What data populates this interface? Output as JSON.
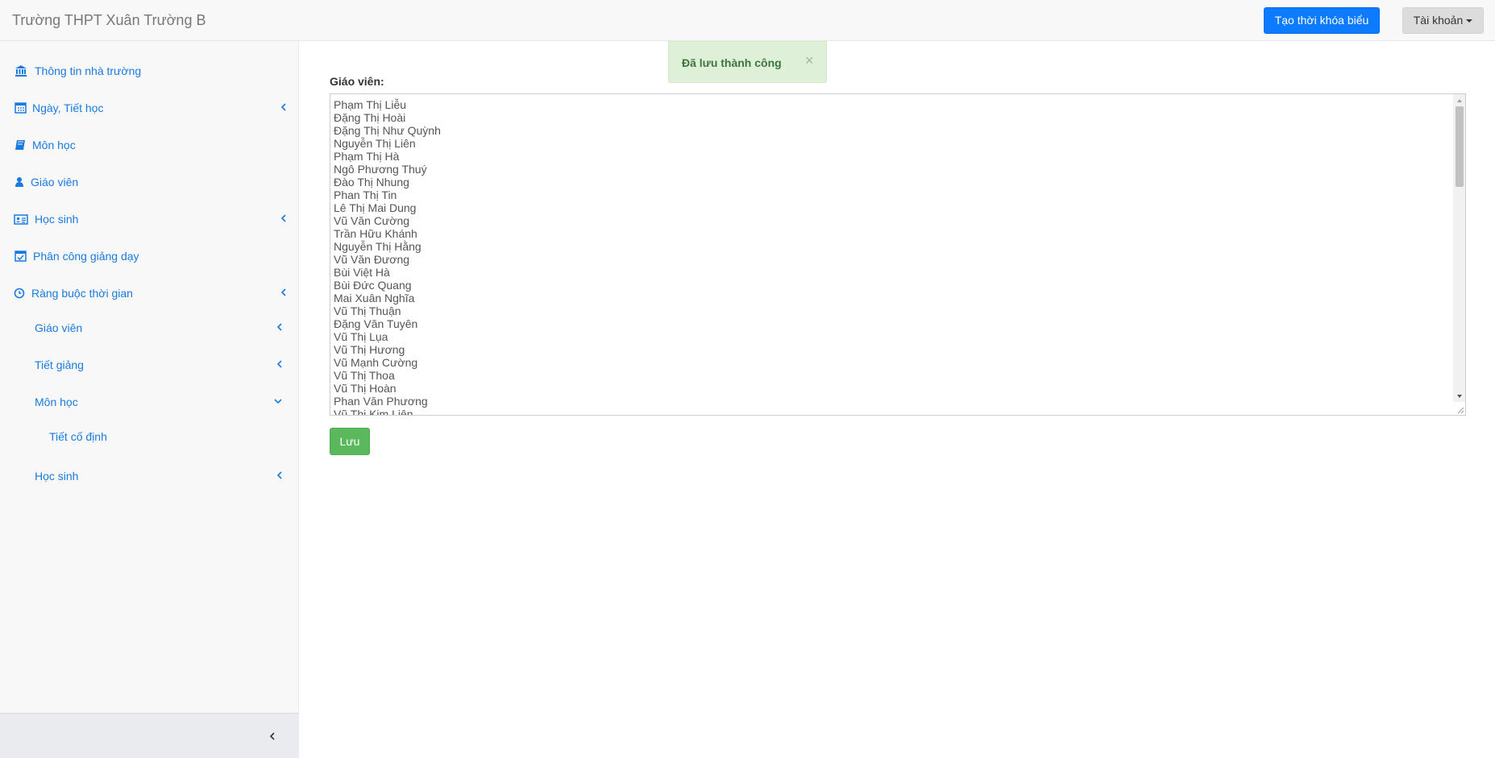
{
  "navbar": {
    "brand": "Trường THPT Xuân Trường B",
    "create_button": "Tạo thời khóa biểu",
    "account_button": "Tài khoản"
  },
  "sidebar": {
    "items": [
      {
        "label": "Thông tin nhà trường",
        "icon": "bank-icon",
        "chevron": "none"
      },
      {
        "label": "Ngày, Tiết học",
        "icon": "calendar-icon",
        "chevron": "left"
      },
      {
        "label": "Môn học",
        "icon": "book-icon",
        "chevron": "none"
      },
      {
        "label": "Giáo viên",
        "icon": "user-icon",
        "chevron": "none"
      },
      {
        "label": "Học sinh",
        "icon": "id-card-icon",
        "chevron": "left"
      },
      {
        "label": "Phân công giảng dạy",
        "icon": "calendar-check-icon",
        "chevron": "none"
      },
      {
        "label": "Ràng buộc thời gian",
        "icon": "clock-icon",
        "chevron": "left"
      }
    ],
    "subitems": [
      {
        "label": "Giáo viên",
        "chevron": "left"
      },
      {
        "label": "Tiết giảng",
        "chevron": "left"
      },
      {
        "label": "Môn học",
        "chevron": "down"
      }
    ],
    "subsubitems": [
      {
        "label": "Tiết cố định"
      }
    ],
    "last_subitem": {
      "label": "Học sinh",
      "chevron": "left"
    }
  },
  "alert": {
    "message": "Đã lưu thành công",
    "close": "×"
  },
  "form": {
    "label": "Giáo viên:",
    "teachers": [
      "Phạm Thị Liễu",
      "Đặng Thị Hoài",
      "Đặng Thị Như Quỳnh",
      "Nguyễn Thị Liên",
      "Phạm Thị Hà",
      "Ngô Phương Thuý",
      "Đào Thị Nhung",
      "Phan Thị Tin",
      "Lê Thị Mai Dung",
      "Vũ Văn Cường",
      "Trần Hữu Khánh",
      "Nguyễn Thị Hằng",
      "Vũ Văn Đương",
      "Bùi Việt Hà",
      "Bùi Đức Quang",
      "Mai Xuân Nghĩa",
      "Vũ Thị Thuận",
      "Đặng Văn Tuyên",
      "Vũ Thị Lụa",
      "Vũ Thị Hương",
      "Vũ Mạnh Cường",
      "Vũ Thị Thoa",
      "Vũ Thị Hoàn",
      "Phan Văn Phương",
      "Vũ Thị Kim Liên"
    ],
    "save_button": "Lưu"
  },
  "colors": {
    "link": "#1a7ae0",
    "primary": "#0d7bff",
    "success": "#5cb85c",
    "alert_bg": "#dff0d8",
    "alert_text": "#3c763d"
  }
}
